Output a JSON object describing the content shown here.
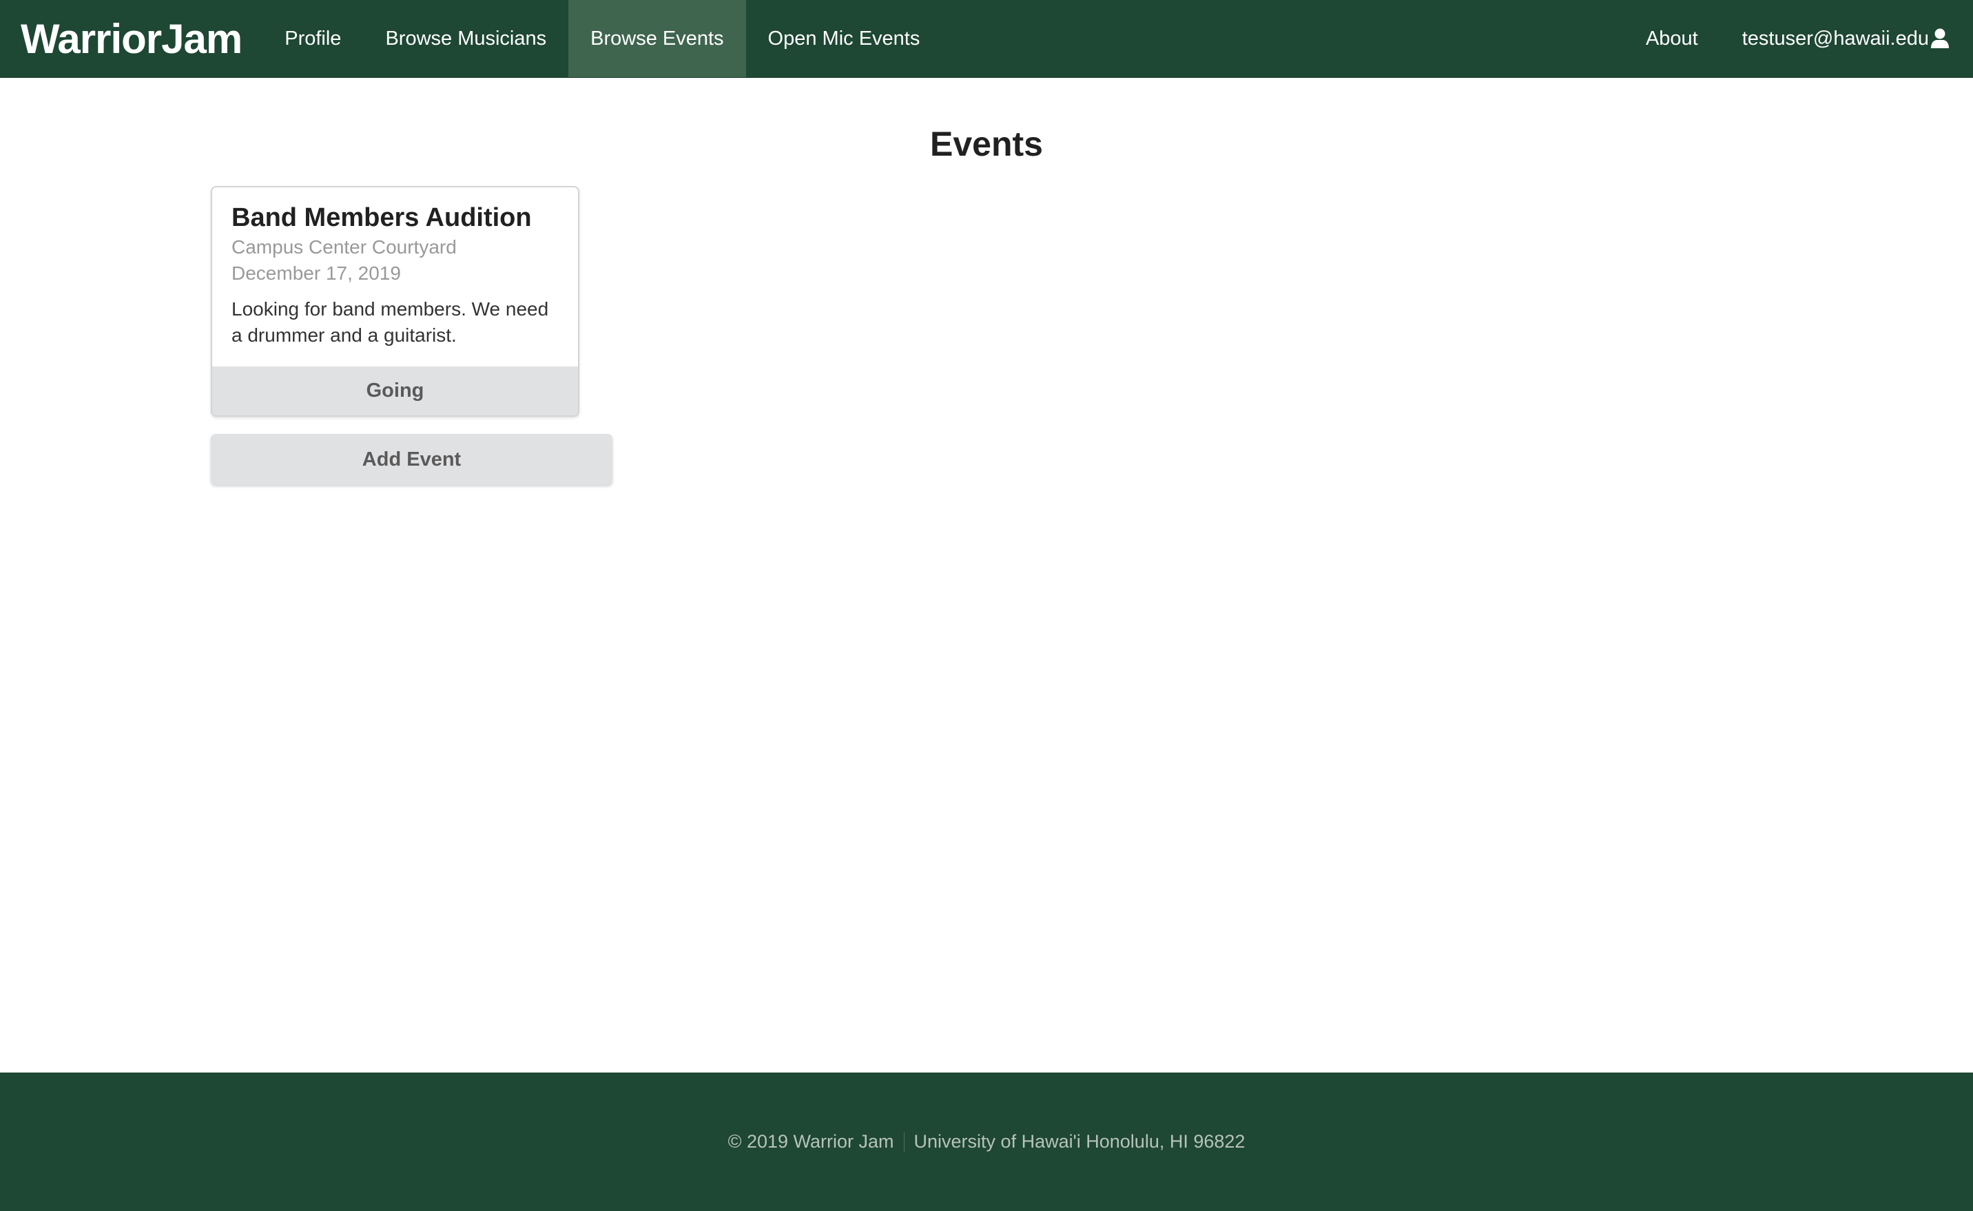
{
  "nav": {
    "brand": "WarriorJam",
    "items": [
      {
        "label": "Profile"
      },
      {
        "label": "Browse Musicians"
      },
      {
        "label": "Browse Events"
      },
      {
        "label": "Open Mic Events"
      }
    ],
    "active_item": "Browse Events",
    "about_label": "About",
    "user_email": "testuser@hawaii.edu",
    "user_icon": "user-icon",
    "background_color": "#1e4734",
    "active_color": "#40654f"
  },
  "main": {
    "title": "Events",
    "events": [
      {
        "name": "Band Members Audition",
        "location": "Campus Center Courtyard",
        "date": "December 17, 2019",
        "description": "Looking for band members. We need a drummer and a guitarist.",
        "action_label": "Going"
      }
    ],
    "add_event_label": "Add Event"
  },
  "footer": {
    "copyright": "© 2019 Warrior Jam",
    "address": "University of Hawai'i Honolulu, HI 96822"
  }
}
